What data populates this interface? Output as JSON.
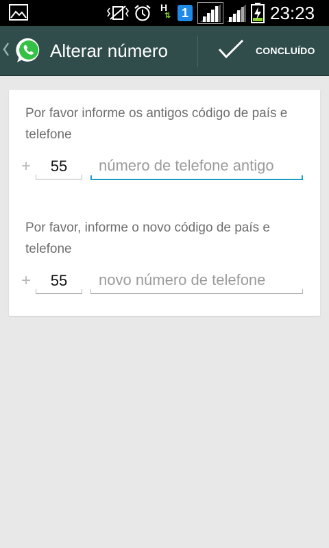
{
  "status_bar": {
    "time": "23:23",
    "network_type": "H",
    "notification_badge": "1",
    "icons": [
      "photo-icon",
      "vibrate-icon",
      "alarm-icon",
      "network-h-icon",
      "badge-one-icon",
      "signal-icon",
      "signal-icon",
      "battery-charging-icon"
    ]
  },
  "action_bar": {
    "title": "Alterar número",
    "done_label": "CONCLUÍDO",
    "background_color": "#304d4c",
    "icons": [
      "back-chevron-icon",
      "whatsapp-logo-icon",
      "checkmark-icon"
    ]
  },
  "form": {
    "old": {
      "instruction": "Por favor informe os antigos código de país e telefone",
      "plus_sign": "+",
      "country_code": "55",
      "phone_placeholder": "número de telefone antigo",
      "phone_value": ""
    },
    "new": {
      "instruction": "Por favor, informe o novo código de país e telefone",
      "plus_sign": "+",
      "country_code": "55",
      "phone_placeholder": "novo número de telefone",
      "phone_value": ""
    },
    "focus_color": "#1f9bc1"
  }
}
